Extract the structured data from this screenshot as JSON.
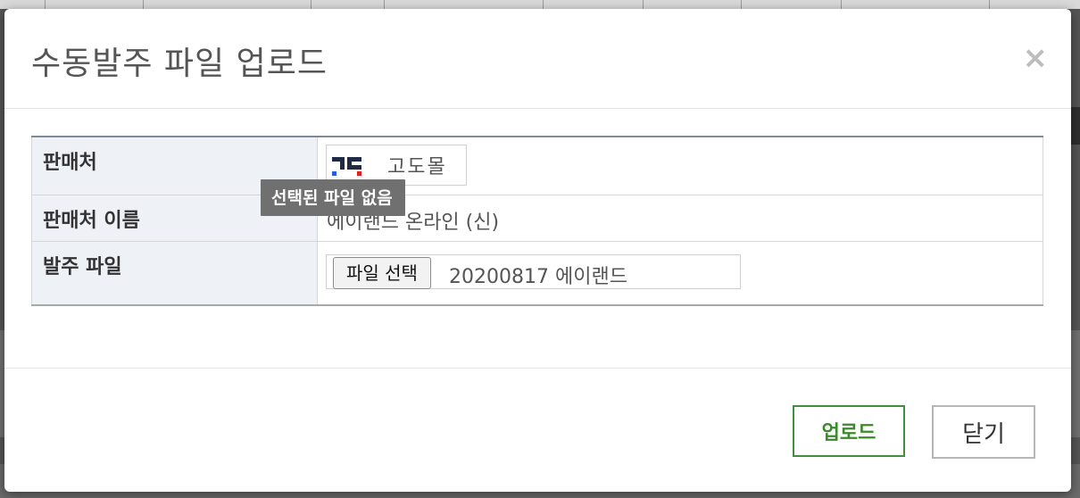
{
  "dialog": {
    "title": "수동발주 파일 업로드",
    "close_glyph": "×"
  },
  "form": {
    "rows": [
      {
        "label": "판매처"
      },
      {
        "label": "판매처 이름"
      },
      {
        "label": "발주 파일"
      }
    ],
    "mall": {
      "name": "고도몰",
      "logo_icon": "godomall-logo-icon"
    },
    "seller_name": "에이랜드 온라인 (신)",
    "file": {
      "button_label": "파일 선택",
      "file_name": "20200817 에이랜드"
    }
  },
  "tooltip": {
    "text": "선택된 파일 없음"
  },
  "footer": {
    "upload_label": "업로드",
    "close_label": "닫기"
  },
  "colors": {
    "upload_accent": "#3a8a2a",
    "tooltip_bg": "#707070",
    "label_bg": "#eef1f6"
  }
}
